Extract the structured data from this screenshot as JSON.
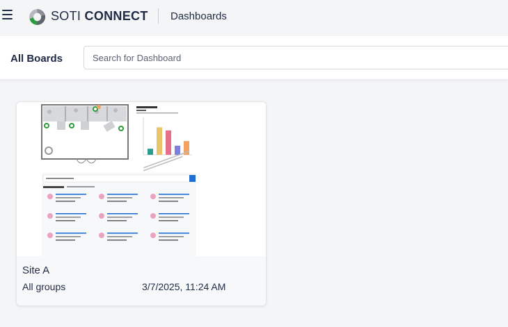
{
  "header": {
    "brand_light": "SOTI ",
    "brand_bold": "CONNECT",
    "section": "Dashboards"
  },
  "toolbar": {
    "title": "All Boards",
    "search_placeholder": "Search for Dashboard"
  },
  "boards": [
    {
      "name": "Site A",
      "groups": "All groups",
      "updated": "3/7/2025, 11:24 AM"
    }
  ],
  "colors": {
    "text": "#1f2a44",
    "logo_green": "#2e9a3c",
    "logo_gray": "#8a8e96",
    "accent_blue": "#1f6ed4"
  },
  "chart_data": {
    "type": "bar",
    "bars": [
      {
        "value": 2,
        "color": "#2a9d8f"
      },
      {
        "value": 9,
        "color": "#e9c46a"
      },
      {
        "value": 8,
        "color": "#e76f8a"
      },
      {
        "value": 3,
        "color": "#7b7fe0"
      },
      {
        "value": 4.5,
        "color": "#f4a261"
      }
    ],
    "ymax": 10
  }
}
